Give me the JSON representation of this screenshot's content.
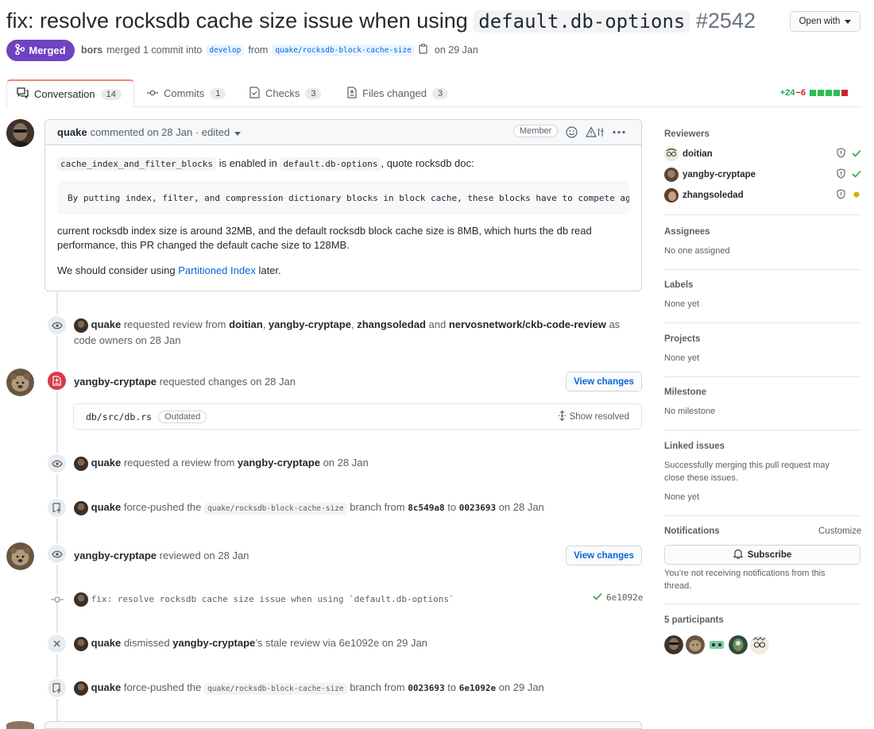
{
  "header": {
    "title_prefix": "fix: resolve rocksdb cache size issue when using ",
    "title_code": "default.db-options",
    "pr_number": "#2542",
    "open_with": "Open with",
    "state": "Merged",
    "merge_user": "bors",
    "merge_text": "merged 1 commit into",
    "base_branch": "develop",
    "from_text": "from",
    "head_branch": "quake/rocksdb-block-cache-size",
    "merge_date": "on 29 Jan"
  },
  "tabs": [
    {
      "label": "Conversation",
      "count": "14"
    },
    {
      "label": "Commits",
      "count": "1"
    },
    {
      "label": "Checks",
      "count": "3"
    },
    {
      "label": "Files changed",
      "count": "3"
    }
  ],
  "diffstat": {
    "additions": "+24",
    "deletions": "−6"
  },
  "comment": {
    "author": "quake",
    "meta": "commented on 28 Jan · edited",
    "badge": "Member",
    "code1": "cache_index_and_filter_blocks",
    "p1_mid": "is enabled in",
    "code2": "default.db-options",
    "p1_end": ", quote rocksdb doc:",
    "quote": "By putting index, filter, and compression dictionary blocks in block cache, these blocks have to compete against",
    "p2": "current rocksdb index size is around 32MB, and the default rocksdb block cache size is 8MB, which hurts the db read performance, this PR changed the default cache size to 128MB.",
    "p3_pre": "We should consider using",
    "p3_link": "Partitioned Index",
    "p3_post": "later."
  },
  "timeline": {
    "review_request": {
      "user": "quake",
      "text1": "requested review from",
      "r1": "doitian",
      "r2": "yangby-cryptape",
      "r3": "zhangsoledad",
      "and": "and",
      "r4": "nervosnetwork/ckb-code-review",
      "as": "as",
      "line2": "code owners on 28 Jan"
    },
    "changes_requested": {
      "user": "yangby-cryptape",
      "text": "requested changes on 28 Jan",
      "button": "View changes",
      "file": "db/src/db.rs",
      "outdated": "Outdated",
      "show_resolved": "Show resolved"
    },
    "review_request2": {
      "user": "quake",
      "text": "requested a review from",
      "target": "yangby-cryptape",
      "date": "on 28 Jan"
    },
    "force_push1": {
      "user": "quake",
      "text": "force-pushed the",
      "branch": "quake/rocksdb-block-cache-size",
      "from": "branch from",
      "sha_from": "8c549a8",
      "to": "to",
      "sha_to": "0023693",
      "date": "on 28 Jan"
    },
    "reviewed": {
      "user": "yangby-cryptape",
      "text": "reviewed on 28 Jan",
      "button": "View changes"
    },
    "commit": {
      "message": "fix: resolve rocksdb cache size issue when using `default.db-options`",
      "sha": "6e1092e"
    },
    "dismissed": {
      "user": "quake",
      "text": "dismissed",
      "target": "yangby-cryptape",
      "text2": "’s stale review via",
      "sha": "6e1092e",
      "date": "on 29 Jan"
    },
    "force_push2": {
      "user": "quake",
      "text": "force-pushed the",
      "branch": "quake/rocksdb-block-cache-size",
      "from": "branch from",
      "sha_from": "0023693",
      "to": "to",
      "sha_to": "6e1092e",
      "date": "on 29 Jan"
    }
  },
  "sidebar": {
    "reviewers_title": "Reviewers",
    "reviewers": [
      {
        "name": "doitian",
        "status": "approved"
      },
      {
        "name": "yangby-cryptape",
        "status": "approved"
      },
      {
        "name": "zhangsoledad",
        "status": "pending"
      }
    ],
    "assignees_title": "Assignees",
    "assignees_value": "No one assigned",
    "labels_title": "Labels",
    "labels_value": "None yet",
    "projects_title": "Projects",
    "projects_value": "None yet",
    "milestone_title": "Milestone",
    "milestone_value": "No milestone",
    "linked_title": "Linked issues",
    "linked_text": "Successfully merging this pull request may close these issues.",
    "linked_value": "None yet",
    "notifications_title": "Notifications",
    "customize": "Customize",
    "subscribe": "Subscribe",
    "notif_text": "You’re not receiving notifications from this thread.",
    "participants_title": "5 participants"
  },
  "colors": {
    "merged": "#6f42c1",
    "link": "#0366d6",
    "added": "#28a745",
    "deleted": "#cb2431",
    "pending": "#dbab09"
  }
}
